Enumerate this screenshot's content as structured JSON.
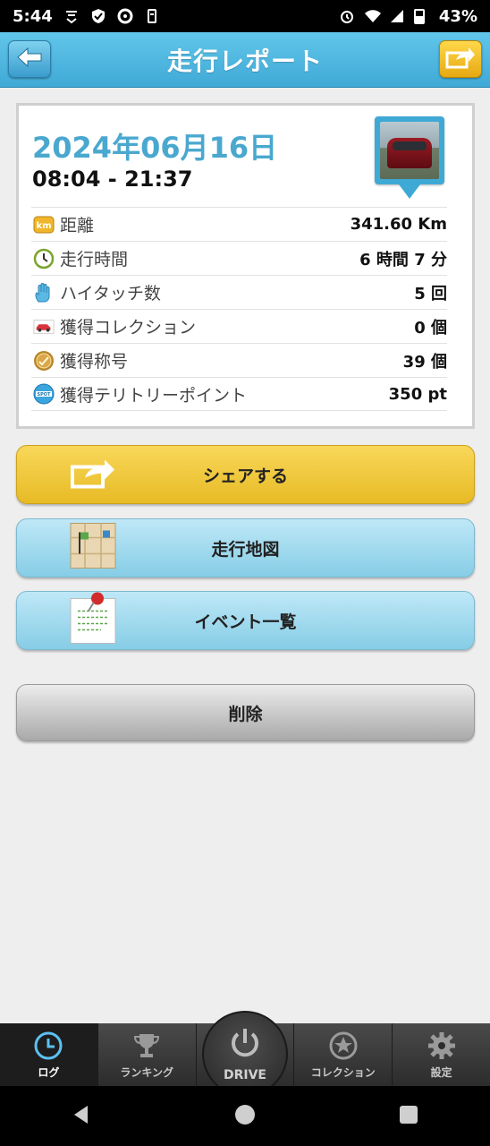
{
  "status_bar": {
    "time": "5:44",
    "battery": "43%"
  },
  "header": {
    "title": "走行レポート",
    "back_icon": "back-arrow-icon",
    "share_icon": "share-icon"
  },
  "report": {
    "date": "2024年06月16日",
    "time_range": "08:04 - 21:37",
    "rows": [
      {
        "icon": "km-icon",
        "label": "距離",
        "value": "341.60 Km"
      },
      {
        "icon": "clock-icon",
        "label": "走行時間",
        "value": "6 時間 7 分"
      },
      {
        "icon": "high-five-icon",
        "label": "ハイタッチ数",
        "value": "5 回"
      },
      {
        "icon": "car-icon",
        "label": "獲得コレクション",
        "value": "0 個"
      },
      {
        "icon": "medal-icon",
        "label": "獲得称号",
        "value": "39 個"
      },
      {
        "icon": "spot-icon",
        "label": "獲得テリトリーポイント",
        "value": "350 pt"
      }
    ]
  },
  "actions": {
    "share": "シェアする",
    "map": "走行地図",
    "events": "イベント一覧",
    "delete": "削除"
  },
  "tabs": [
    {
      "label": "ログ",
      "icon": "clock-icon"
    },
    {
      "label": "ランキング",
      "icon": "trophy-icon"
    },
    {
      "label": "DRIVE",
      "icon": "power-icon"
    },
    {
      "label": "コレクション",
      "icon": "star-icon"
    },
    {
      "label": "設定",
      "icon": "gear-icon"
    }
  ],
  "colors": {
    "header": "#3fa9d6",
    "date": "#4aa8cf",
    "share_button": "#e8bb25",
    "info_button": "#86cde6",
    "delete_button": "#a9a9a9"
  }
}
